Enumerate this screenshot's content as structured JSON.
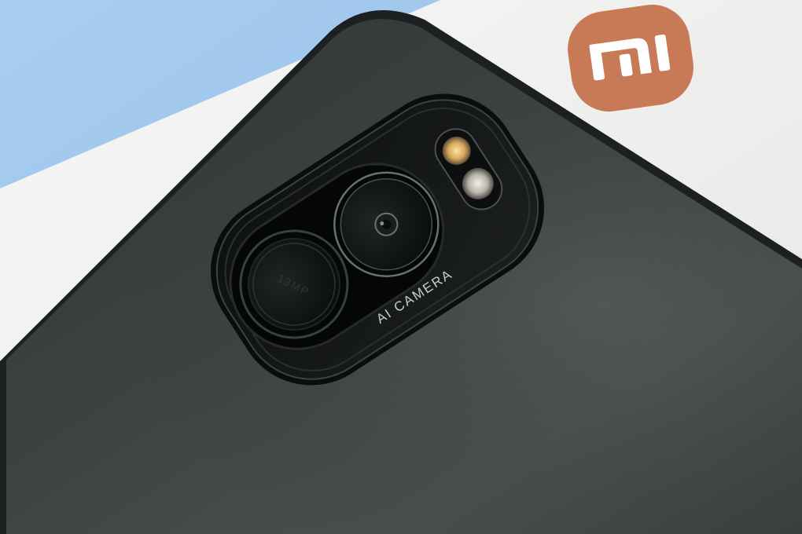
{
  "photo": {
    "subject": "smartphone-camera-module",
    "lens_text": "13MP",
    "module_text": "AI CAMERA",
    "box_logo_text": "MI"
  },
  "colors": {
    "background_blue": "#9ec4ea",
    "box_white": "#f1f1f1",
    "logo_orange": "#c77a55",
    "phone_body": "#353a38",
    "module_black": "#141616"
  }
}
